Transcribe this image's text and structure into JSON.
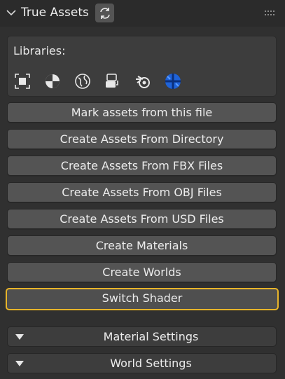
{
  "panel": {
    "title": "True Assets",
    "refresh_icon": "refresh-icon",
    "drag_icon": "drag-handle-icon"
  },
  "libraries": {
    "label": "Libraries:",
    "icons": [
      "frame-select-icon",
      "material-sphere-icon",
      "world-globe-icon",
      "file-import-icon",
      "blender-logo-icon",
      "globe-blue-icon"
    ]
  },
  "buttons": {
    "mark_assets": "Mark assets from this file",
    "from_directory": "Create Assets From Directory",
    "from_fbx": "Create Assets From FBX Files",
    "from_obj": "Create Assets From OBJ Files",
    "from_usd": "Create Assets From USD Files",
    "materials": "Create Materials",
    "worlds": "Create Worlds",
    "switch_shader": "Switch Shader"
  },
  "subpanels": {
    "material_settings": "Material Settings",
    "world_settings": "World Settings"
  },
  "colors": {
    "highlight_border": "#e8b52a",
    "button_bg": "#545454",
    "panel_bg": "#303030"
  }
}
